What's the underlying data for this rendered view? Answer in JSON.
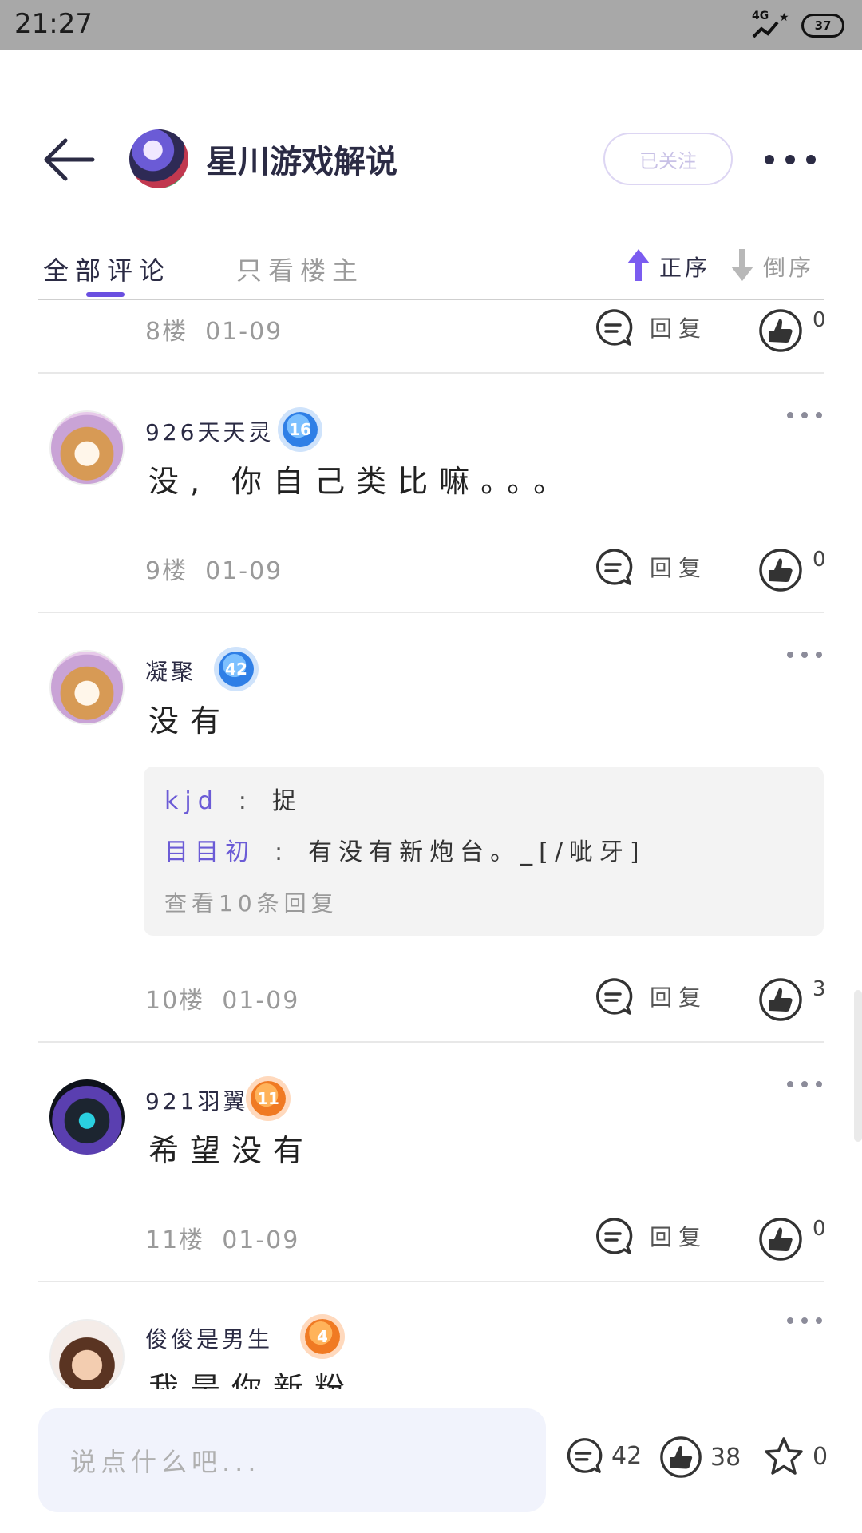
{
  "status_bar": {
    "time": "21:27",
    "network": "4G",
    "battery": "37"
  },
  "header": {
    "title": "星川游戏解说",
    "follow_label": "已关注"
  },
  "tabs": {
    "all": "全部评论",
    "owner_only": "只看楼主"
  },
  "sort": {
    "ascending": "正序",
    "descending": "倒序"
  },
  "reply_label": "回复",
  "comments": [
    {
      "floor": "8楼",
      "date": "01-09",
      "likes": "0"
    },
    {
      "user": "926天天灵",
      "level": "16",
      "text": "没, 你自己类比嘛。。。",
      "floor": "9楼",
      "date": "01-09",
      "likes": "0"
    },
    {
      "user": "凝聚",
      "level": "42",
      "text": "没有",
      "floor": "10楼",
      "date": "01-09",
      "likes": "3",
      "replies": [
        {
          "user": "kjd",
          "sep": ":",
          "text": "捉"
        },
        {
          "user": "目目初",
          "sep": ":",
          "text": "有没有新炮台。_[/呲牙]"
        }
      ],
      "view_replies": "查看10条回复"
    },
    {
      "user": "921羽翼",
      "level": "11",
      "text": "希望没有",
      "floor": "11楼",
      "date": "01-09",
      "likes": "0"
    },
    {
      "user": "俊俊是男生",
      "level": "4",
      "text": "我是你新粉"
    }
  ],
  "bottom_bar": {
    "placeholder": "说点什么吧...",
    "comment_count": "42",
    "like_count": "38",
    "fav_count": "0"
  },
  "colors": {
    "accent": "#6a4fe0",
    "reply_user": "#6b5bd6",
    "status_bar": "#a8a8a8"
  },
  "icons": [
    "back-arrow-icon",
    "more-dots-icon",
    "arrow-up-icon",
    "arrow-down-icon",
    "comment-bubble-icon",
    "thumbs-up-icon",
    "star-icon",
    "signal-icon"
  ]
}
